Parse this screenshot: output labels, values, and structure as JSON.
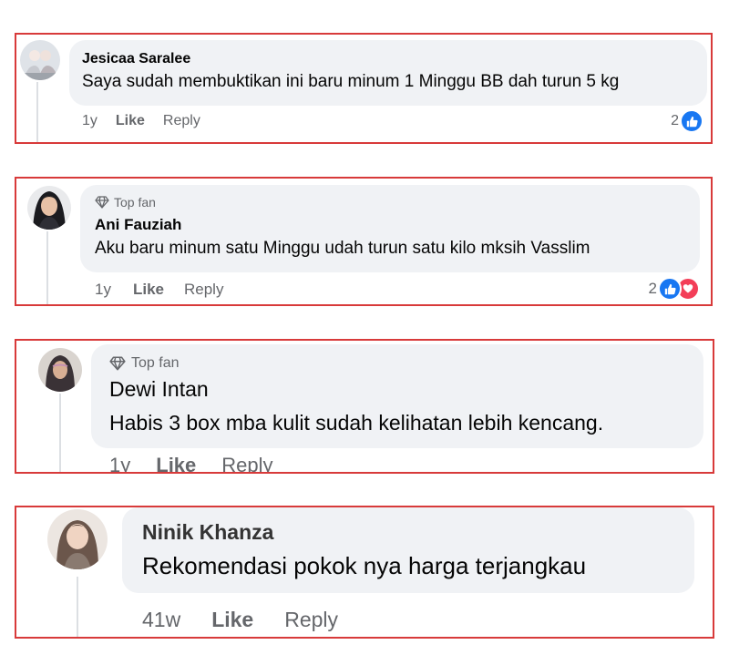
{
  "comments": [
    {
      "top_fan": "",
      "author": "Jesicaa Saralee",
      "text": "Saya sudah membuktikan ini baru minum 1 Minggu BB dah turun 5 kg",
      "time": "1y",
      "like_label": "Like",
      "reply_label": "Reply",
      "reaction_count": "2",
      "reactions": [
        "like-icon"
      ]
    },
    {
      "top_fan": "Top fan",
      "author": "Ani Fauziah",
      "text": "Aku baru minum satu Minggu udah turun satu kilo mksih Vasslim",
      "time": "1y",
      "like_label": "Like",
      "reply_label": "Reply",
      "reaction_count": "2",
      "reactions": [
        "like-icon",
        "love-icon"
      ]
    },
    {
      "top_fan": "Top fan",
      "author": "Dewi Intan",
      "text": "Habis 3 box mba kulit sudah kelihatan lebih kencang.",
      "time": "1y",
      "like_label": "Like",
      "reply_label": "Reply"
    },
    {
      "top_fan": "",
      "author": "Ninik Khanza",
      "text": "Rekomendasi pokok nya harga terjangkau",
      "time": "41w",
      "like_label": "Like",
      "reply_label": "Reply"
    }
  ],
  "colors": {
    "highlight_border": "#d83a3a",
    "bubble_bg": "#f0f2f5",
    "meta_text": "#65676b",
    "like_blue": "#1877f2",
    "love_red": "#f33e58"
  }
}
